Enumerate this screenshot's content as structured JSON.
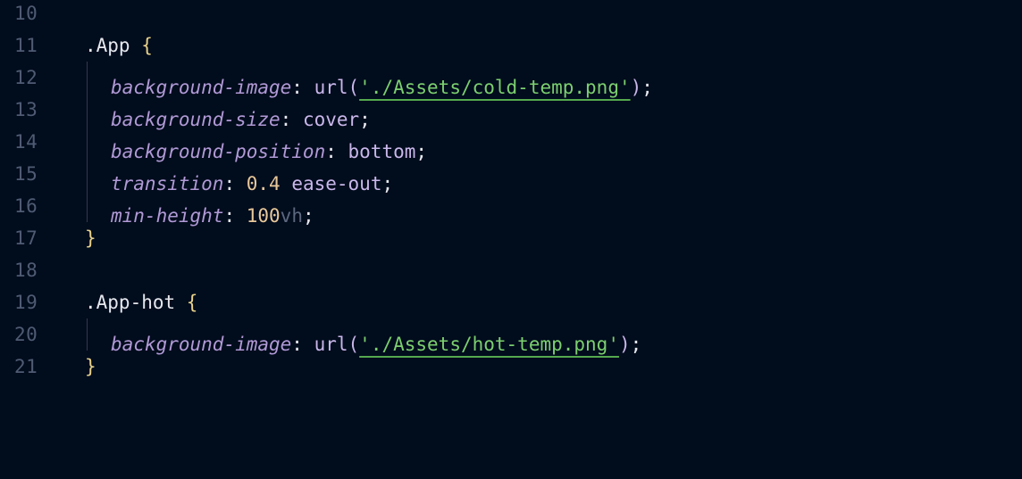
{
  "editor": {
    "lines": [
      {
        "num": "10"
      },
      {
        "num": "11",
        "selector": ".App",
        "open_brace": " {"
      },
      {
        "num": "12",
        "prop": "background-image",
        "colon": ": ",
        "fn": "url(",
        "str": "'./Assets/cold-temp.png'",
        "fn_close": ")",
        "semi": ";"
      },
      {
        "num": "13",
        "prop": "background-size",
        "colon": ": ",
        "value": "cover",
        "semi": ";"
      },
      {
        "num": "14",
        "prop": "background-position",
        "colon": ": ",
        "value": "bottom",
        "semi": ";"
      },
      {
        "num": "15",
        "prop": "transition",
        "colon": ": ",
        "number": "0.4",
        "value": " ease-out",
        "semi": ";"
      },
      {
        "num": "16",
        "prop": "min-height",
        "colon": ": ",
        "number": "100",
        "unit": "vh",
        "semi": ";"
      },
      {
        "num": "17",
        "close_brace": "}"
      },
      {
        "num": "18"
      },
      {
        "num": "19",
        "selector": ".App-hot",
        "open_brace": " {"
      },
      {
        "num": "20",
        "prop": "background-image",
        "colon": ": ",
        "fn": "url(",
        "str": "'./Assets/hot-temp.png'",
        "fn_close": ")",
        "semi": ";"
      },
      {
        "num": "21",
        "close_brace": "}"
      }
    ]
  },
  "colors": {
    "background": "#010c1d",
    "line_number": "#4f5b73",
    "property": "#b19ad6",
    "string": "#7ccf6f",
    "number": "#e8c89a",
    "brace": "#e8d28a"
  }
}
